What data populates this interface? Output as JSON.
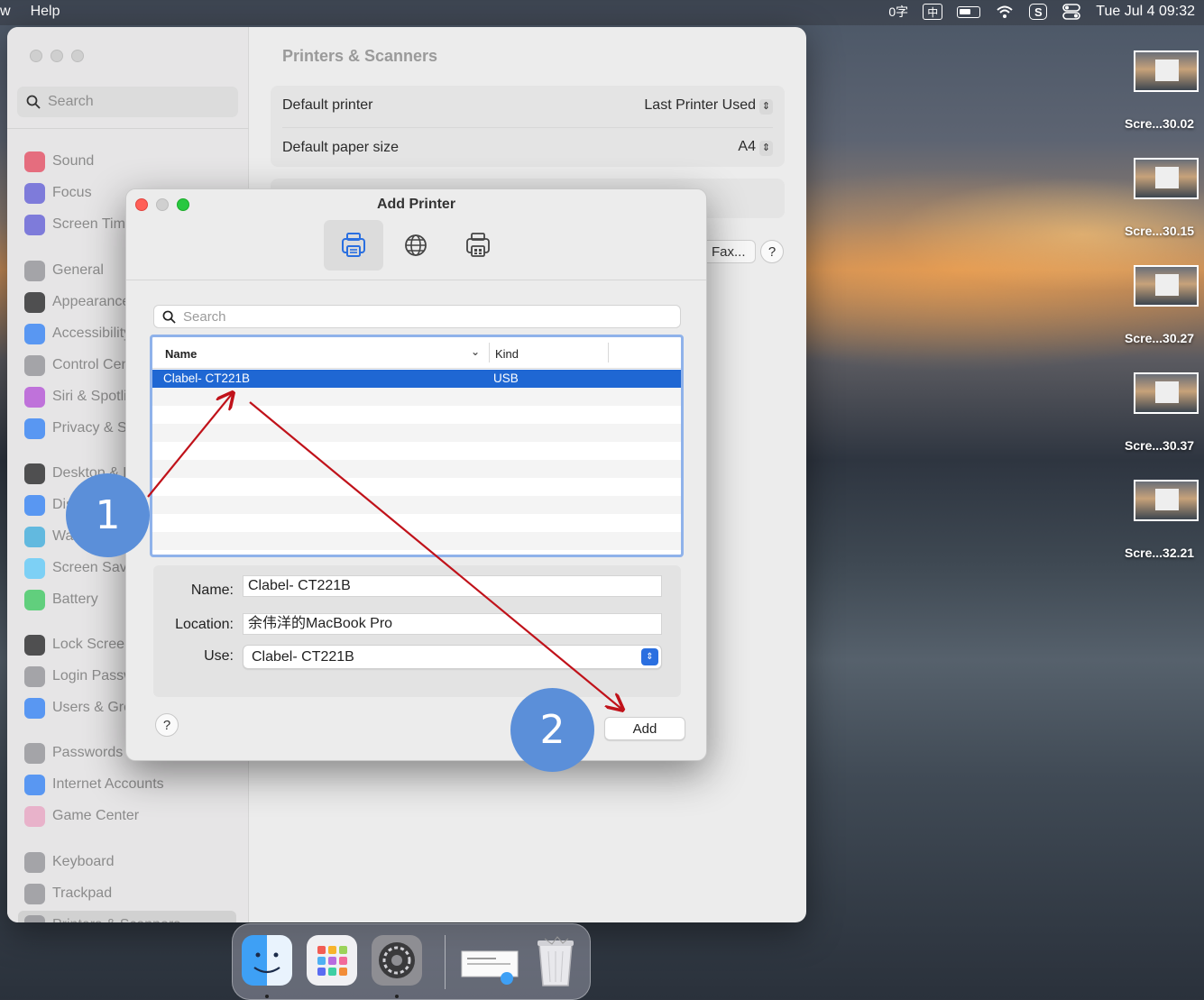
{
  "menubar": {
    "left": [
      "w",
      "Help"
    ],
    "ime_text": "0字",
    "ime_box": "中",
    "sogou": "S",
    "clock": "Tue Jul 4  09:32"
  },
  "settings": {
    "search_placeholder": "Search",
    "sidebar_items": [
      {
        "label": "Sound",
        "color": "#e4445b"
      },
      {
        "label": "Focus",
        "color": "#5b57d6"
      },
      {
        "label": "Screen Time",
        "color": "#5b57d6"
      },
      {
        "label": "General",
        "color": "#8e8e93"
      },
      {
        "label": "Appearance",
        "color": "#1c1c1e"
      },
      {
        "label": "Accessibility",
        "color": "#2a7cf6"
      },
      {
        "label": "Control Centre",
        "color": "#8e8e93"
      },
      {
        "label": "Siri & Spotlight",
        "color": "#b14bd6"
      },
      {
        "label": "Privacy & Security",
        "color": "#2a7cf6"
      },
      {
        "label": "Desktop & Dock",
        "color": "#1c1c1e"
      },
      {
        "label": "Displays",
        "color": "#2a7cf6"
      },
      {
        "label": "Wallpaper",
        "color": "#35aadc"
      },
      {
        "label": "Screen Saver",
        "color": "#5ac8fa"
      },
      {
        "label": "Battery",
        "color": "#34c759"
      },
      {
        "label": "Lock Screen",
        "color": "#1c1c1e"
      },
      {
        "label": "Login Password",
        "color": "#8e8e93"
      },
      {
        "label": "Users & Groups",
        "color": "#2a7cf6"
      },
      {
        "label": "Passwords",
        "color": "#8e8e93"
      },
      {
        "label": "Internet Accounts",
        "color": "#2a7cf6"
      },
      {
        "label": "Game Center",
        "color": "#e8a0c0"
      },
      {
        "label": "Keyboard",
        "color": "#8e8e93"
      },
      {
        "label": "Trackpad",
        "color": "#8e8e93"
      },
      {
        "label": "Printers & Scanners",
        "color": "#8e8e93"
      }
    ],
    "title": "Printers & Scanners",
    "default_printer_label": "Default printer",
    "default_printer_value": "Last Printer Used",
    "default_paper_label": "Default paper size",
    "default_paper_value": "A4",
    "fax_button": "Fax...",
    "help": "?"
  },
  "dialog": {
    "title": "Add Printer",
    "search_placeholder": "Search",
    "col_name": "Name",
    "col_kind": "Kind",
    "printer_name": "Clabel- CT221B",
    "printer_kind": "USB",
    "name_label": "Name:",
    "name_value": "Clabel- CT221B",
    "location_label": "Location:",
    "location_value": "余伟洋的MacBook Pro",
    "use_label": "Use:",
    "use_value": "Clabel- CT221B",
    "help": "?",
    "add_button": "Add"
  },
  "desktop_files": [
    "Scre...30.02",
    "Scre...30.15",
    "Scre...30.27",
    "Scre...30.37",
    "Scre...32.21"
  ],
  "annotations": {
    "step1": "1",
    "step2": "2",
    "arrow_color": "#c0121a",
    "badge_color": "#5b8fd9"
  },
  "colors": {
    "selection": "#1f67d3",
    "accent": "#2a6fe0"
  }
}
